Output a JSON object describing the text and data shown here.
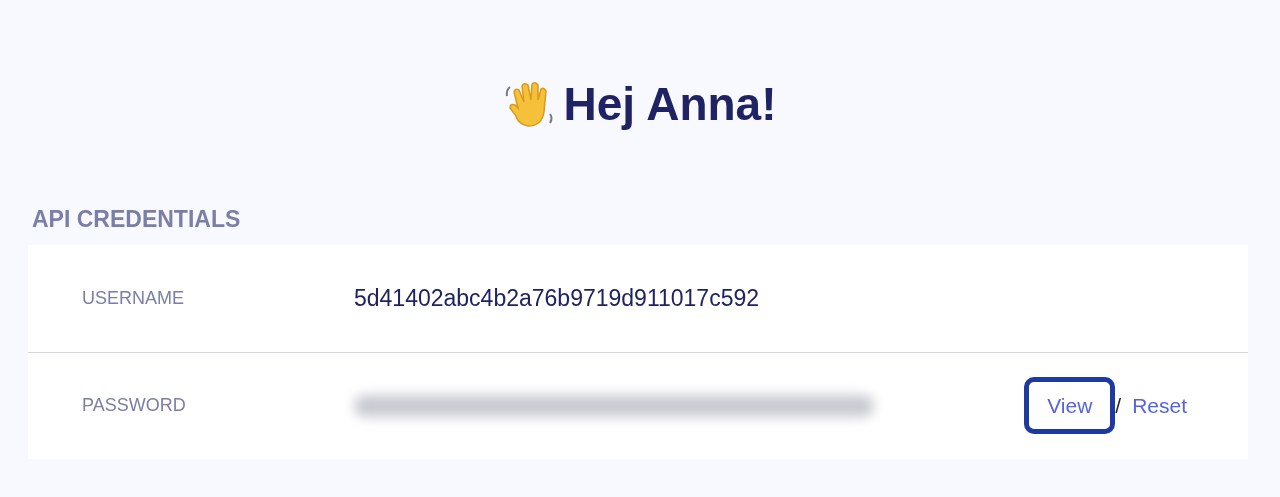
{
  "greeting": "Hej Anna!",
  "section_title": "API CREDENTIALS",
  "credentials": [
    {
      "kind": "text",
      "label": "USERNAME",
      "value": "5d41402abc4b2a76b9719d911017c592"
    },
    {
      "kind": "secret",
      "label": "PASSWORD",
      "actions": [
        {
          "label": "View",
          "highlighted": true
        },
        {
          "label": "Reset",
          "highlighted": false
        }
      ],
      "separator": "/"
    }
  ]
}
